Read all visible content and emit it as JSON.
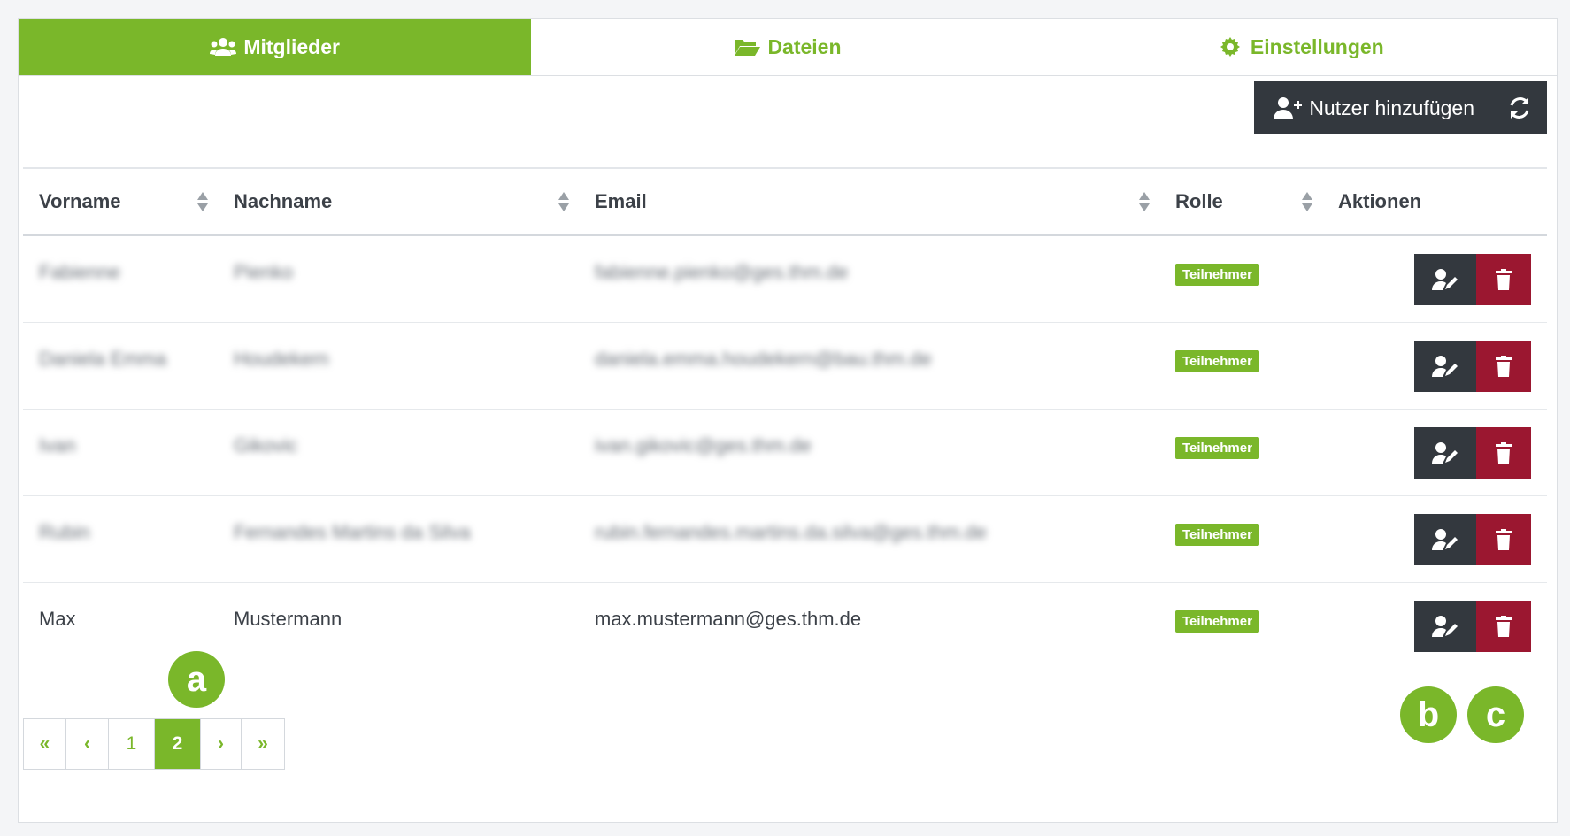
{
  "tabs": [
    {
      "label": "Mitglieder",
      "icon": "users-icon",
      "active": true
    },
    {
      "label": "Dateien",
      "icon": "folder-open-icon",
      "active": false
    },
    {
      "label": "Einstellungen",
      "icon": "gear-icon",
      "active": false
    }
  ],
  "toolbar": {
    "add_user_label": "Nutzer hinzufügen",
    "add_icon": "user-plus-icon",
    "refresh_icon": "refresh-icon"
  },
  "table": {
    "headers": [
      "Vorname",
      "Nachname",
      "Email",
      "Rolle",
      "Aktionen"
    ],
    "rows": [
      {
        "first": "Fabienne",
        "last": "Pienko",
        "email": "fabienne.pienko@ges.thm.de",
        "role": "Teilnehmer",
        "blurred": true
      },
      {
        "first": "Daniela Emma",
        "last": "Houdekern",
        "email": "daniela.emma.houdekern@bau.thm.de",
        "role": "Teilnehmer",
        "blurred": true
      },
      {
        "first": "Ivan",
        "last": "Gikovic",
        "email": "ivan.gikovic@ges.thm.de",
        "role": "Teilnehmer",
        "blurred": true
      },
      {
        "first": "Rubin",
        "last": "Fernandes Martins da Silva",
        "email": "rubin.fernandes.martins.da.silva@ges.thm.de",
        "role": "Teilnehmer",
        "blurred": true
      },
      {
        "first": "Max",
        "last": "Mustermann",
        "email": "max.mustermann@ges.thm.de",
        "role": "Teilnehmer",
        "blurred": false
      }
    ]
  },
  "pagination": {
    "first": "«",
    "prev": "‹",
    "pages": [
      "1",
      "2"
    ],
    "current": "2",
    "next": "›",
    "last": "»"
  },
  "markers": {
    "a": "a",
    "b": "b",
    "c": "c"
  },
  "colors": {
    "accent": "#7ab72a",
    "dark": "#33383e",
    "danger": "#9b1730"
  }
}
